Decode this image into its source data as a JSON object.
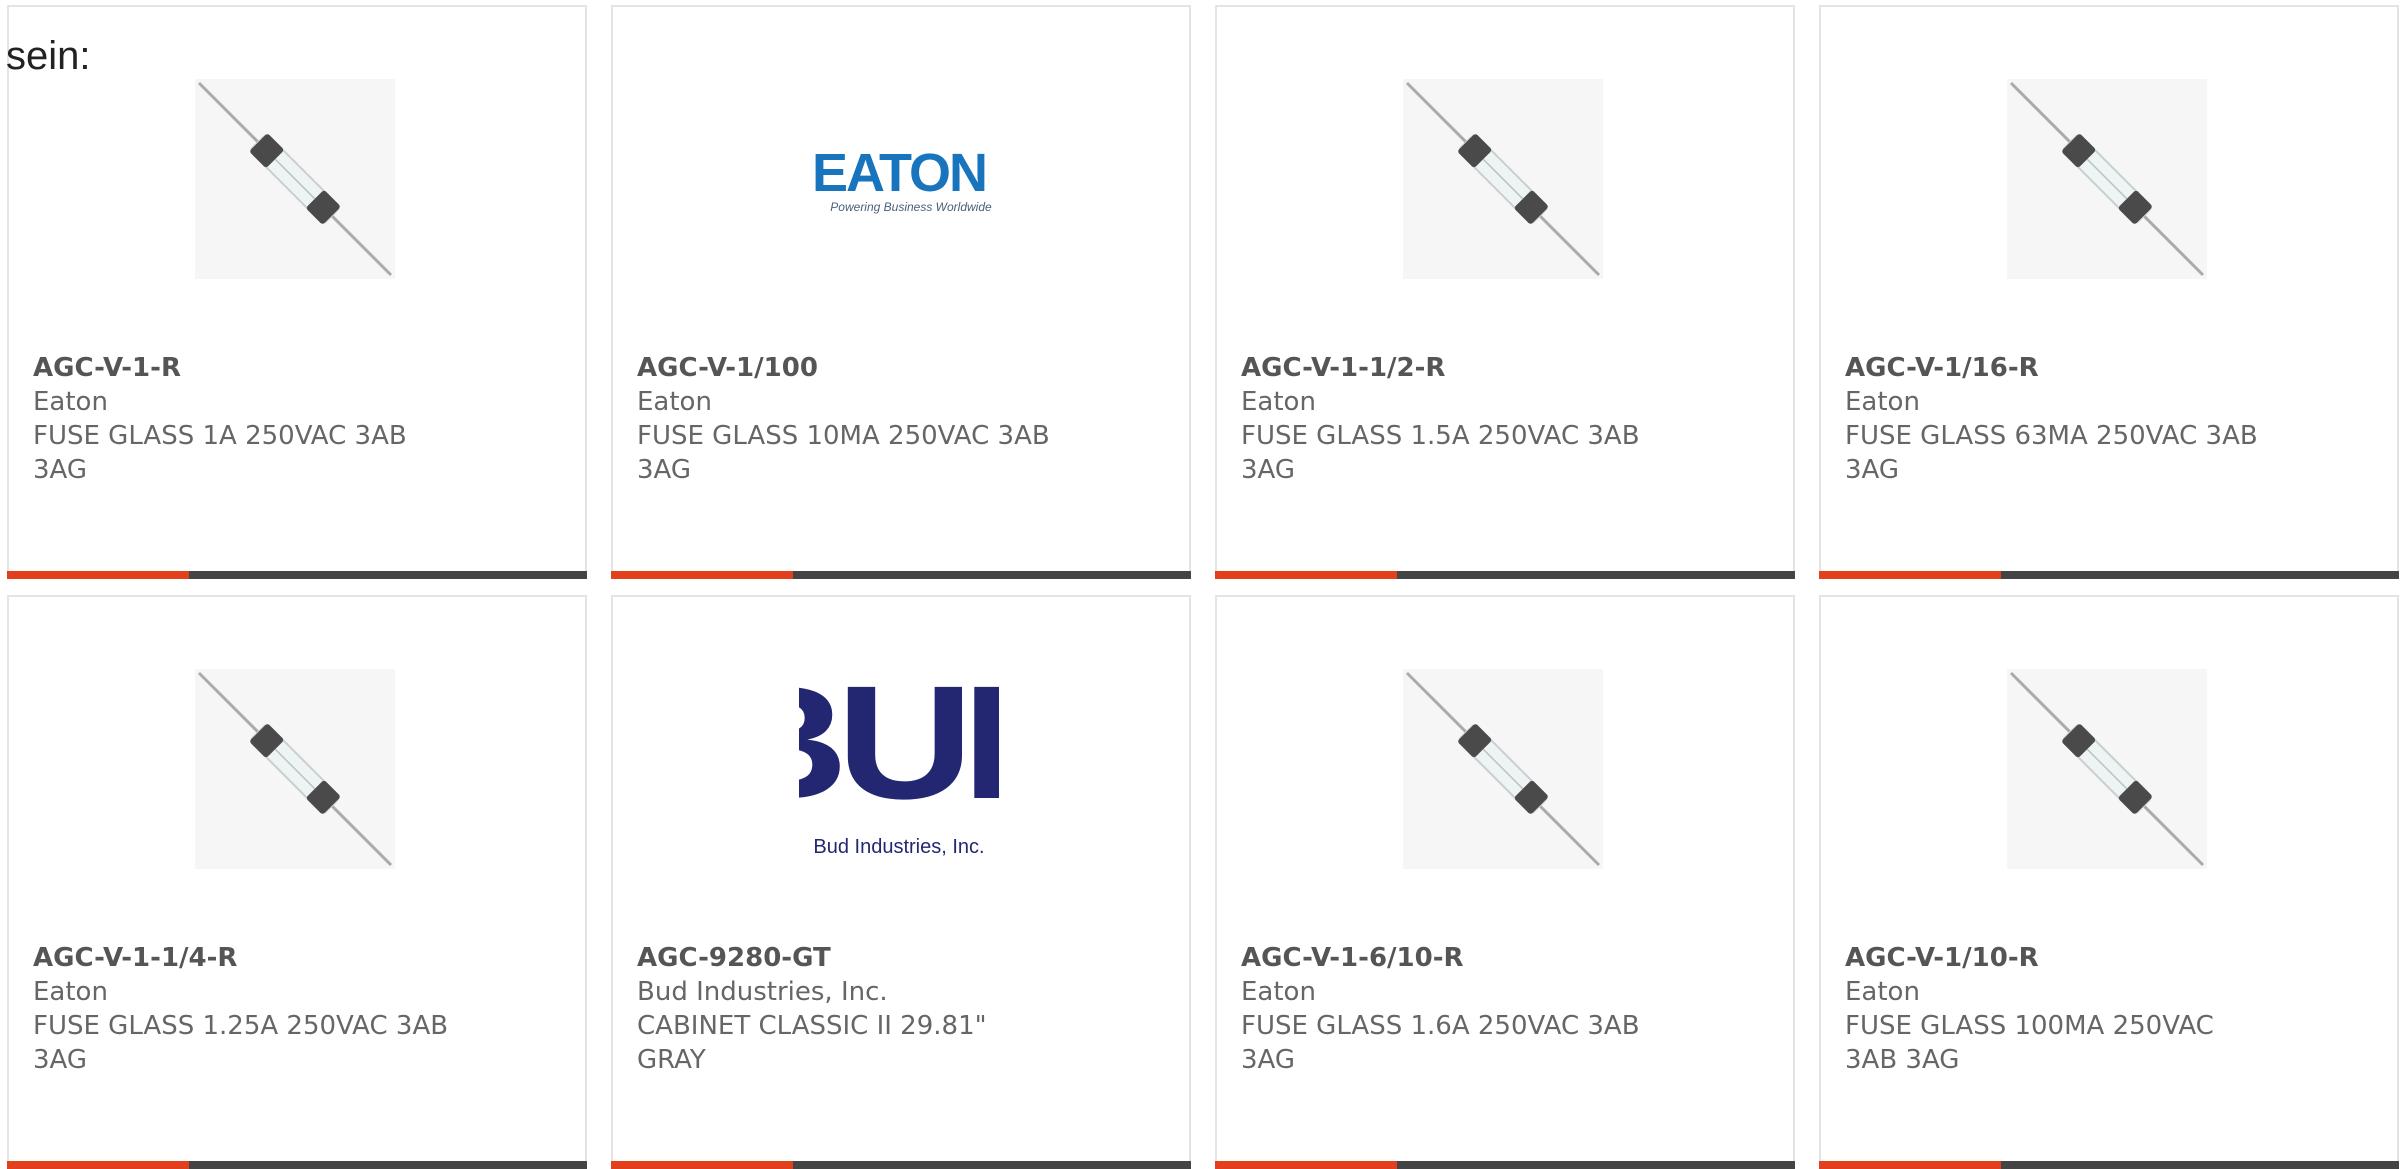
{
  "intro_text": "sein:",
  "colors": {
    "accent": "#e2401c",
    "bar": "#444444",
    "eaton_blue": "#1875bd",
    "bud_navy": "#232772"
  },
  "products": [
    {
      "part": "AGC-V-1-R",
      "maker": "Eaton",
      "desc": "FUSE GLASS 1A 250VAC 3AB 3AG",
      "image": "fuse-image"
    },
    {
      "part": "AGC-V-1/100",
      "maker": "Eaton",
      "desc": "FUSE GLASS 10MA 250VAC 3AB 3AG",
      "image": "eaton-logo",
      "logo_name": "EATON",
      "logo_tagline": "Powering Business Worldwide"
    },
    {
      "part": "AGC-V-1-1/2-R",
      "maker": "Eaton",
      "desc": "FUSE GLASS 1.5A 250VAC 3AB 3AG",
      "image": "fuse-image"
    },
    {
      "part": "AGC-V-1/16-R",
      "maker": "Eaton",
      "desc": "FUSE GLASS 63MA 250VAC 3AB 3AG",
      "image": "fuse-image"
    },
    {
      "part": "AGC-V-1-1/4-R",
      "maker": "Eaton",
      "desc": "FUSE GLASS 1.25A 250VAC 3AB 3AG",
      "image": "fuse-image"
    },
    {
      "part": "AGC-9280-GT",
      "maker": "Bud Industries, Inc.",
      "desc": "CABINET CLASSIC II 29.81\" GRAY",
      "image": "bud-logo",
      "logo_name": "BUD",
      "logo_tagline": "Bud Industries, Inc."
    },
    {
      "part": "AGC-V-1-6/10-R",
      "maker": "Eaton",
      "desc": "FUSE GLASS 1.6A 250VAC 3AB 3AG",
      "image": "fuse-image"
    },
    {
      "part": "AGC-V-1/10-R",
      "maker": "Eaton",
      "desc": "FUSE GLASS 100MA 250VAC 3AB 3AG",
      "image": "fuse-image"
    }
  ]
}
